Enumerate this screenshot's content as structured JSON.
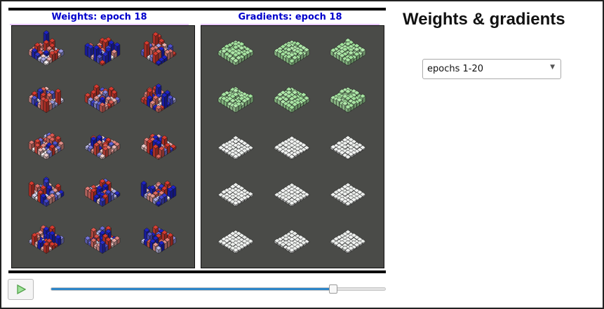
{
  "app": {
    "title": "Weights & gradients"
  },
  "panels": {
    "weights_title": "Weights: epoch 18",
    "gradients_title": "Gradients: epoch 18",
    "grid_rows": 5,
    "grid_cols": 3
  },
  "controls": {
    "epoch_range": "epochs 1-20",
    "play_icon": "play-icon",
    "slider_value": 0.84
  },
  "colors": {
    "panel_bg": "#4a4b48",
    "positive": "#d83a2e",
    "negative": "#1d22c8",
    "neutral": "#f2eef0",
    "gradient_high": "#9fe29a",
    "gradient_low": "#e9ece9",
    "accent": "#2d85c8",
    "title_text": "#0000cc"
  }
}
